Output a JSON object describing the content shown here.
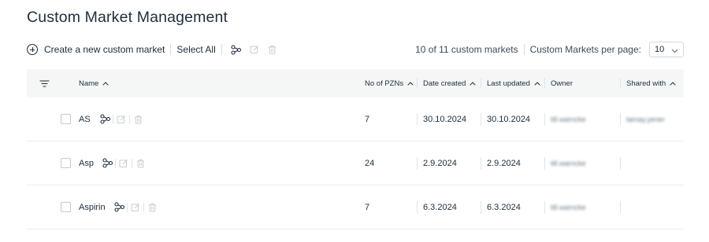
{
  "page": {
    "title": "Custom Market Management"
  },
  "toolbar": {
    "create_label": "Create a new custom market",
    "select_all_label": "Select All",
    "count_text": "10 of 11 custom markets",
    "per_page_label": "Custom Markets per page:",
    "per_page_value": "10"
  },
  "table": {
    "headers": {
      "name": "Name",
      "pzns": "No of PZNs",
      "created": "Date created",
      "updated": "Last updated",
      "owner": "Owner",
      "shared": "Shared with"
    },
    "rows": [
      {
        "name": "AS",
        "pzns": "7",
        "created": "30.10.2024",
        "updated": "30.10.2024",
        "owner": "till.warncke",
        "shared": "tamay.yener"
      },
      {
        "name": "Asp",
        "pzns": "24",
        "created": "2.9.2024",
        "updated": "2.9.2024",
        "owner": "till.warncke",
        "shared": ""
      },
      {
        "name": "Aspirin",
        "pzns": "7",
        "created": "6.3.2024",
        "updated": "6.3.2024",
        "owner": "till.warncke",
        "shared": ""
      }
    ]
  },
  "icons": {
    "create": "plus-circle-icon",
    "share": "share-nodes-icon",
    "edit": "edit-icon",
    "delete": "trash-icon",
    "filter": "filter-lines-icon",
    "sort": "chevron-up-icon",
    "dropdown": "chevron-down-icon"
  },
  "colors": {
    "text": "#1c2b39",
    "header_bg": "#f5f7f7",
    "border": "#e7ebed",
    "disabled_icon": "#c5cdd2"
  }
}
